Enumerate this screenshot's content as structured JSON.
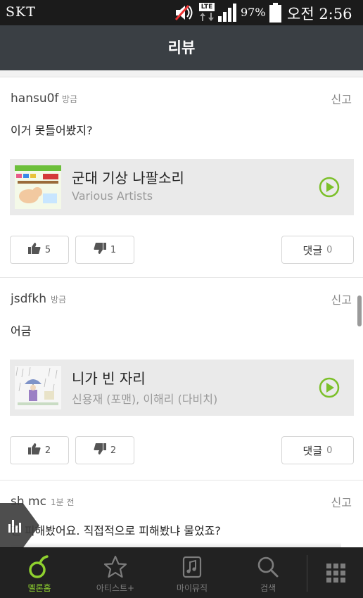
{
  "status_bar": {
    "carrier": "SKT",
    "network": "LTE",
    "battery_percent": "97%",
    "time": "오전 2:56",
    "icons": [
      "mute-icon",
      "lte-icon",
      "signal-icon",
      "battery-icon"
    ]
  },
  "header": {
    "title": "리뷰"
  },
  "reviews": [
    {
      "author": "hansu0f",
      "time": "방금",
      "report_label": "신고",
      "text": "이거 못들어봤지?",
      "song": {
        "title": "군대 기상 나팔소리",
        "artist": "Various Artists"
      },
      "likes": "5",
      "dislikes": "1",
      "comment_label": "댓글",
      "comment_count": "0"
    },
    {
      "author": "jsdfkh",
      "time": "방금",
      "report_label": "신고",
      "text": "어금",
      "song": {
        "title": "니가 빈 자리",
        "artist": "신용재 (포맨), 이해리 (다비치)"
      },
      "likes": "2",
      "dislikes": "2",
      "comment_label": "댓글",
      "comment_count": "0"
    },
    {
      "author": "sh mc",
      "time": "1분 전",
      "report_label": "신고",
      "text": "전 피해봤어요. 직접적으로 피해봤냐 물었죠?"
    }
  ],
  "bottom_nav": {
    "tabs": [
      {
        "label": "멜론홈",
        "icon": "melon-home-icon",
        "active": true
      },
      {
        "label": "아티스트+",
        "icon": "star-icon",
        "active": false
      },
      {
        "label": "마이뮤직",
        "icon": "music-note-icon",
        "active": false
      },
      {
        "label": "검색",
        "icon": "search-icon",
        "active": false
      }
    ],
    "more_icon": "grid-menu-icon"
  },
  "colors": {
    "accent_green": "#8fd12f",
    "header_bg": "#3a3f44",
    "nav_bg": "#222222",
    "card_bg": "#eaeaea"
  }
}
